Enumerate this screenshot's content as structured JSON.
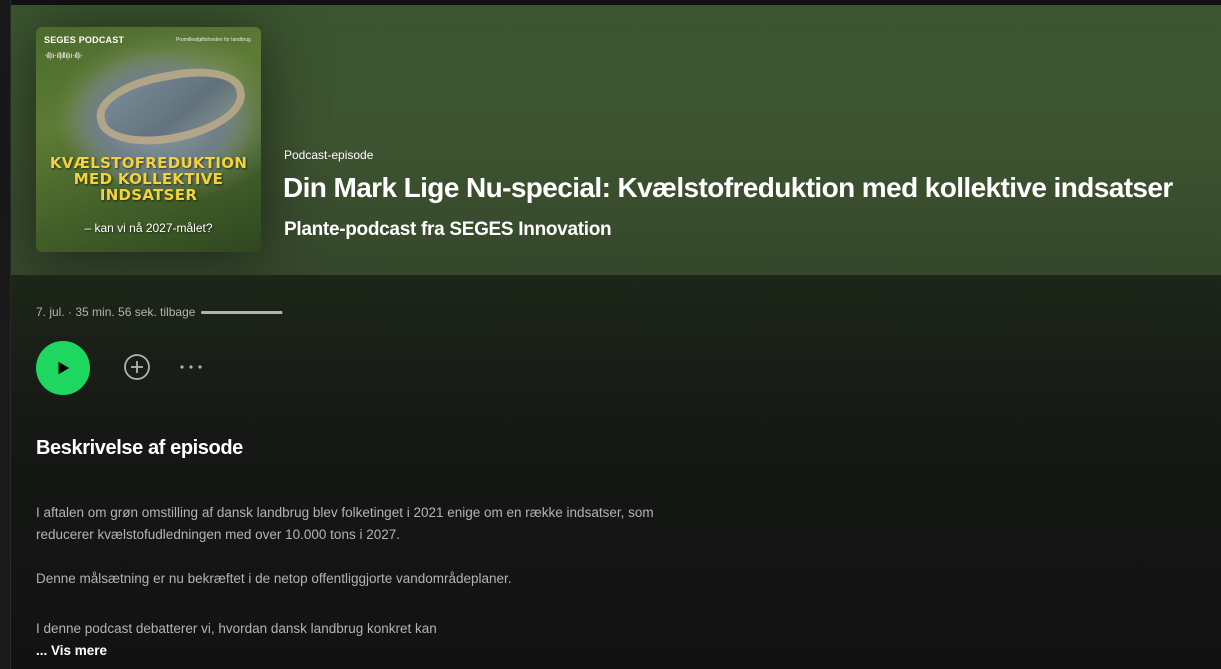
{
  "cover": {
    "brand": "SEGES PODCAST",
    "small_text": "Promilleafgiftsfonden for landbrug",
    "title_line1": "KVÆLSTOFREDUKTION",
    "title_line2": "MED KOLLEKTIVE",
    "title_line3": "INDSATSER",
    "subtitle": "– kan vi nå 2027-målet?"
  },
  "header": {
    "type_label": "Podcast-episode",
    "title": "Din Mark Lige Nu-special: Kvælstofreduktion med kollektive indsatser",
    "show_name": "Plante-podcast fra SEGES Innovation"
  },
  "meta": {
    "text": "7. jul. · 35 min. 56 sek. tilbage",
    "progress_fraction": 0.98
  },
  "actions": {
    "play_icon": "play-icon",
    "add_icon": "add-circle-icon",
    "more_icon": "more-icon"
  },
  "description": {
    "heading": "Beskrivelse af episode",
    "paragraph1": "I aftalen om grøn omstilling af dansk landbrug blev folketinget i 2021 enige om en række indsatser, som reducerer kvælstofudledningen med over 10.000 tons i 2027.",
    "paragraph2": "Denne målsætning er nu bekræftet i de netop offentliggjorte vandområdeplaner.",
    "paragraph3": "I denne podcast debatterer vi, hvordan dansk landbrug konkret kan",
    "show_more": "... Vis mere"
  },
  "colors": {
    "accent": "#1ed760",
    "header_bg": "#3d5330",
    "background": "#121212",
    "cover_title": "#f3d33b"
  }
}
